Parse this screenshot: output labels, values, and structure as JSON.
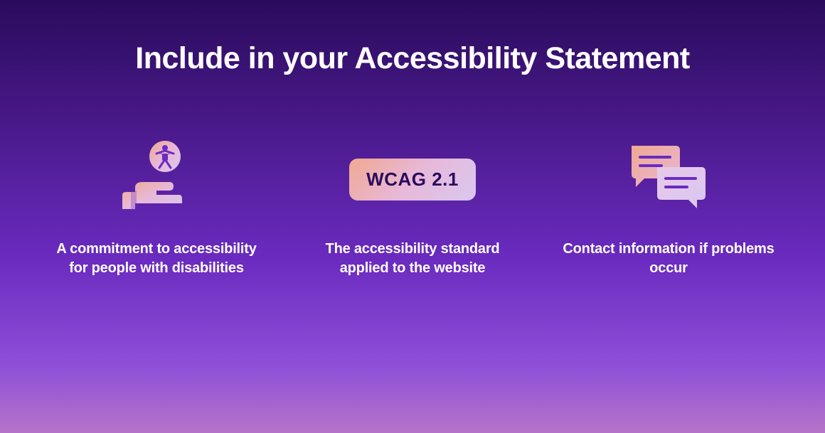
{
  "heading": "Include in your Accessibility Statement",
  "items": [
    {
      "caption": "A commitment to accessibility for people with disabilities",
      "icon": "hand-accessibility-icon"
    },
    {
      "caption": "The accessibility standard applied to the website",
      "icon": "wcag-badge",
      "badge_text": "WCAG 2.1"
    },
    {
      "caption": "Contact information if problems occur",
      "icon": "chat-bubbles-icon"
    }
  ]
}
